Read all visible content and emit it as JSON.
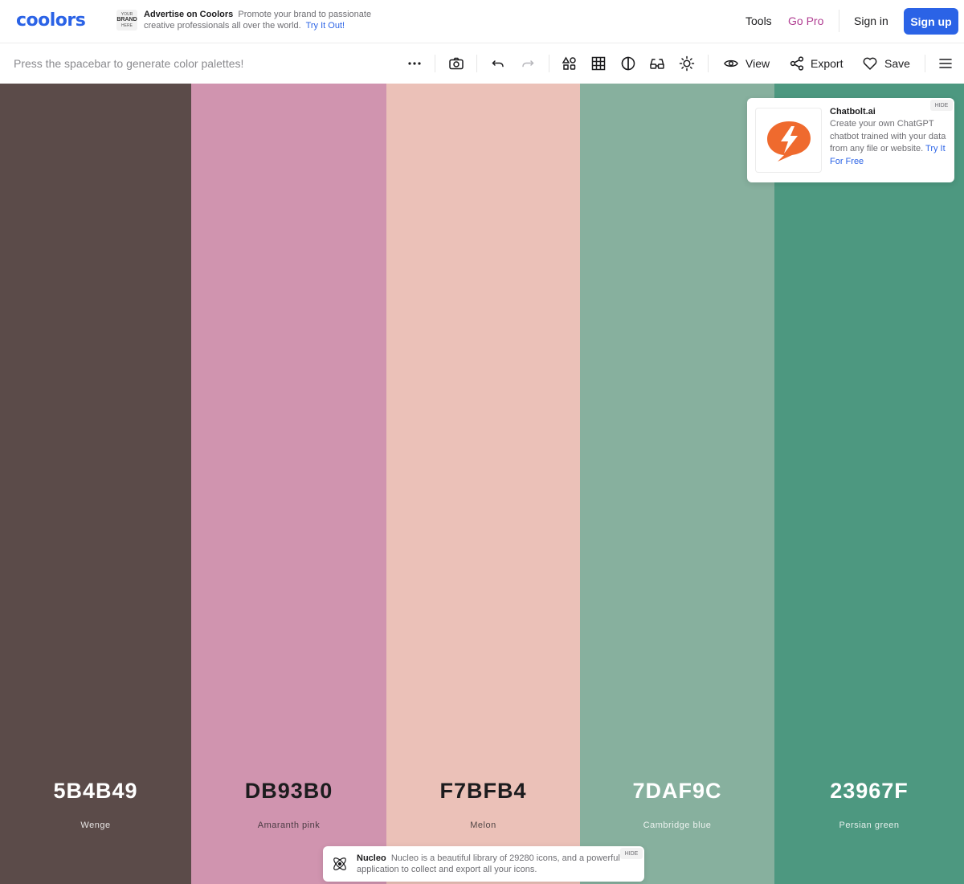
{
  "header": {
    "logo": "coolors",
    "brand_box": {
      "line1": "YOUR",
      "line2": "BRAND",
      "line3": "HERE"
    },
    "ad_title": "Advertise on Coolors",
    "ad_text": "Promote your brand to passionate creative professionals all over the world.",
    "ad_link": "Try It Out!",
    "tools": "Tools",
    "go_pro": "Go Pro",
    "sign_in": "Sign in",
    "sign_up": "Sign up"
  },
  "toolbar": {
    "hint": "Press the spacebar to generate color palettes!",
    "view": "View",
    "export": "Export",
    "save": "Save",
    "icons": [
      "more-icon",
      "camera-icon",
      "undo-icon",
      "redo-icon",
      "shapes-icon",
      "grid-icon",
      "contrast-icon",
      "glasses-icon",
      "brightness-icon",
      "eye-icon",
      "share-icon",
      "heart-icon",
      "menu-icon"
    ]
  },
  "palette": [
    {
      "hex": "5B4B49",
      "name": "Wenge",
      "color": "#5B4B49",
      "text_color": "#ffffff"
    },
    {
      "hex": "DB93B0",
      "name": "Amaranth pink",
      "color": "#D094AF",
      "text_color": "#1c1c1e"
    },
    {
      "hex": "F7BFB4",
      "name": "Melon",
      "color": "#EBC1B8",
      "text_color": "#1c1c1e"
    },
    {
      "hex": "7DAF9C",
      "name": "Cambridge blue",
      "color": "#87B09E",
      "text_color": "#ffffff"
    },
    {
      "hex": "23967F",
      "name": "Persian green",
      "color": "#4D9880",
      "text_color": "#ffffff"
    }
  ],
  "chatbolt_ad": {
    "hide": "HIDE",
    "title": "Chatbolt.ai",
    "text": "Create your own ChatGPT chatbot trained with your data from any file or website.",
    "link": "Try It For Free",
    "accent": "#EF6A2E"
  },
  "nucleo_ad": {
    "hide": "HIDE",
    "title": "Nucleo",
    "text": "Nucleo is a beautiful library of 29280 icons, and a powerful application to collect and export all your icons."
  }
}
